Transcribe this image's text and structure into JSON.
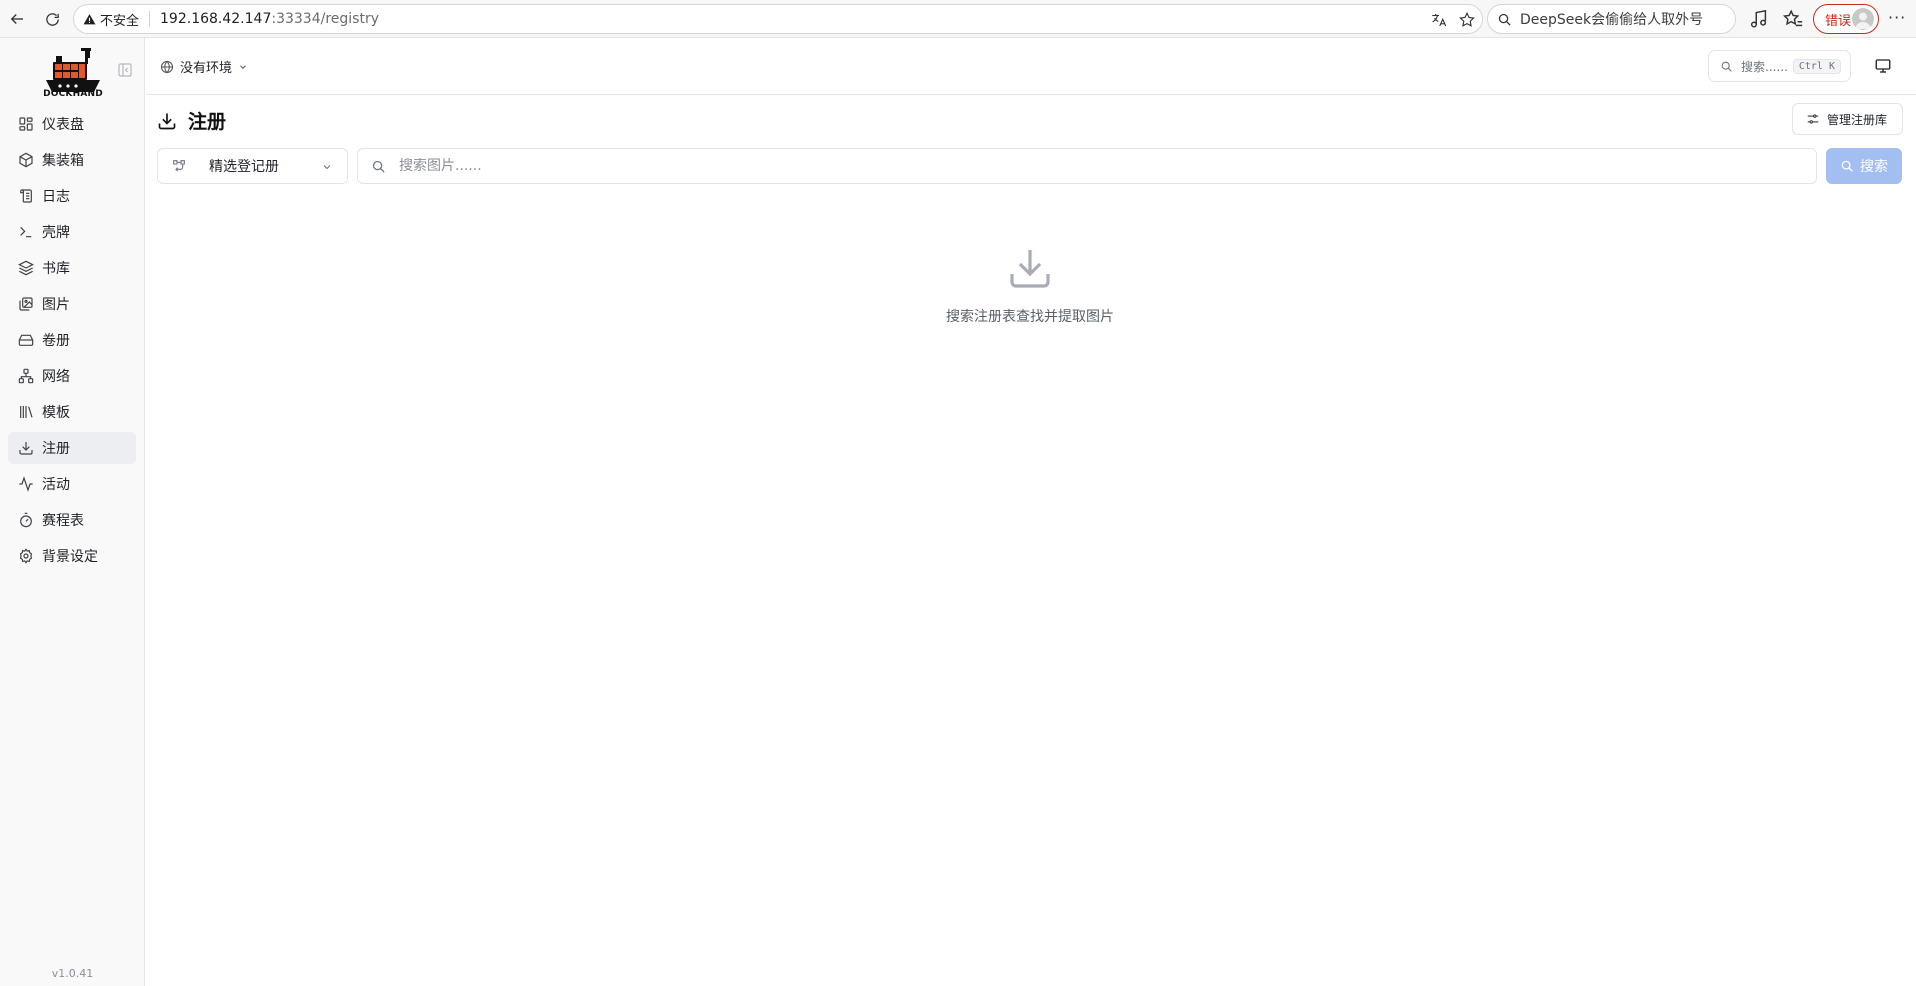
{
  "browser": {
    "security_label": "不安全",
    "url_host": "192.168.42.147",
    "url_rest": ":33334/registry",
    "search_text": "DeepSeek会偷偷给人取外号",
    "error_label": "错误",
    "more_label": "···"
  },
  "app": {
    "logo_text": "DOCKHAND",
    "version": "v1.0.41"
  },
  "sidebar": {
    "items": [
      {
        "label": "仪表盘",
        "icon": "dashboard-icon"
      },
      {
        "label": "集装箱",
        "icon": "container-icon"
      },
      {
        "label": "日志",
        "icon": "logs-icon"
      },
      {
        "label": "壳牌",
        "icon": "terminal-icon"
      },
      {
        "label": "书库",
        "icon": "stacks-icon"
      },
      {
        "label": "图片",
        "icon": "images-icon"
      },
      {
        "label": "卷册",
        "icon": "volume-icon"
      },
      {
        "label": "网络",
        "icon": "network-icon"
      },
      {
        "label": "模板",
        "icon": "templates-icon"
      },
      {
        "label": "注册",
        "icon": "registry-icon",
        "active": true
      },
      {
        "label": "活动",
        "icon": "activity-icon"
      },
      {
        "label": "赛程表",
        "icon": "timer-icon"
      },
      {
        "label": "背景设定",
        "icon": "settings-icon"
      }
    ]
  },
  "header": {
    "environment": "没有环境",
    "search_placeholder": "搜索......",
    "shortcut": "Ctrl K"
  },
  "main": {
    "title": "注册",
    "manage_button": "管理注册库",
    "registry_selected": "精选登记册",
    "image_search_placeholder": "搜索图片......",
    "search_button": "搜索",
    "empty_message": "搜索注册表查找并提取图片"
  },
  "colors": {
    "accent_disabled": "#a3bef0",
    "error": "#c42b1c",
    "active_nav_bg": "#eceef1"
  }
}
